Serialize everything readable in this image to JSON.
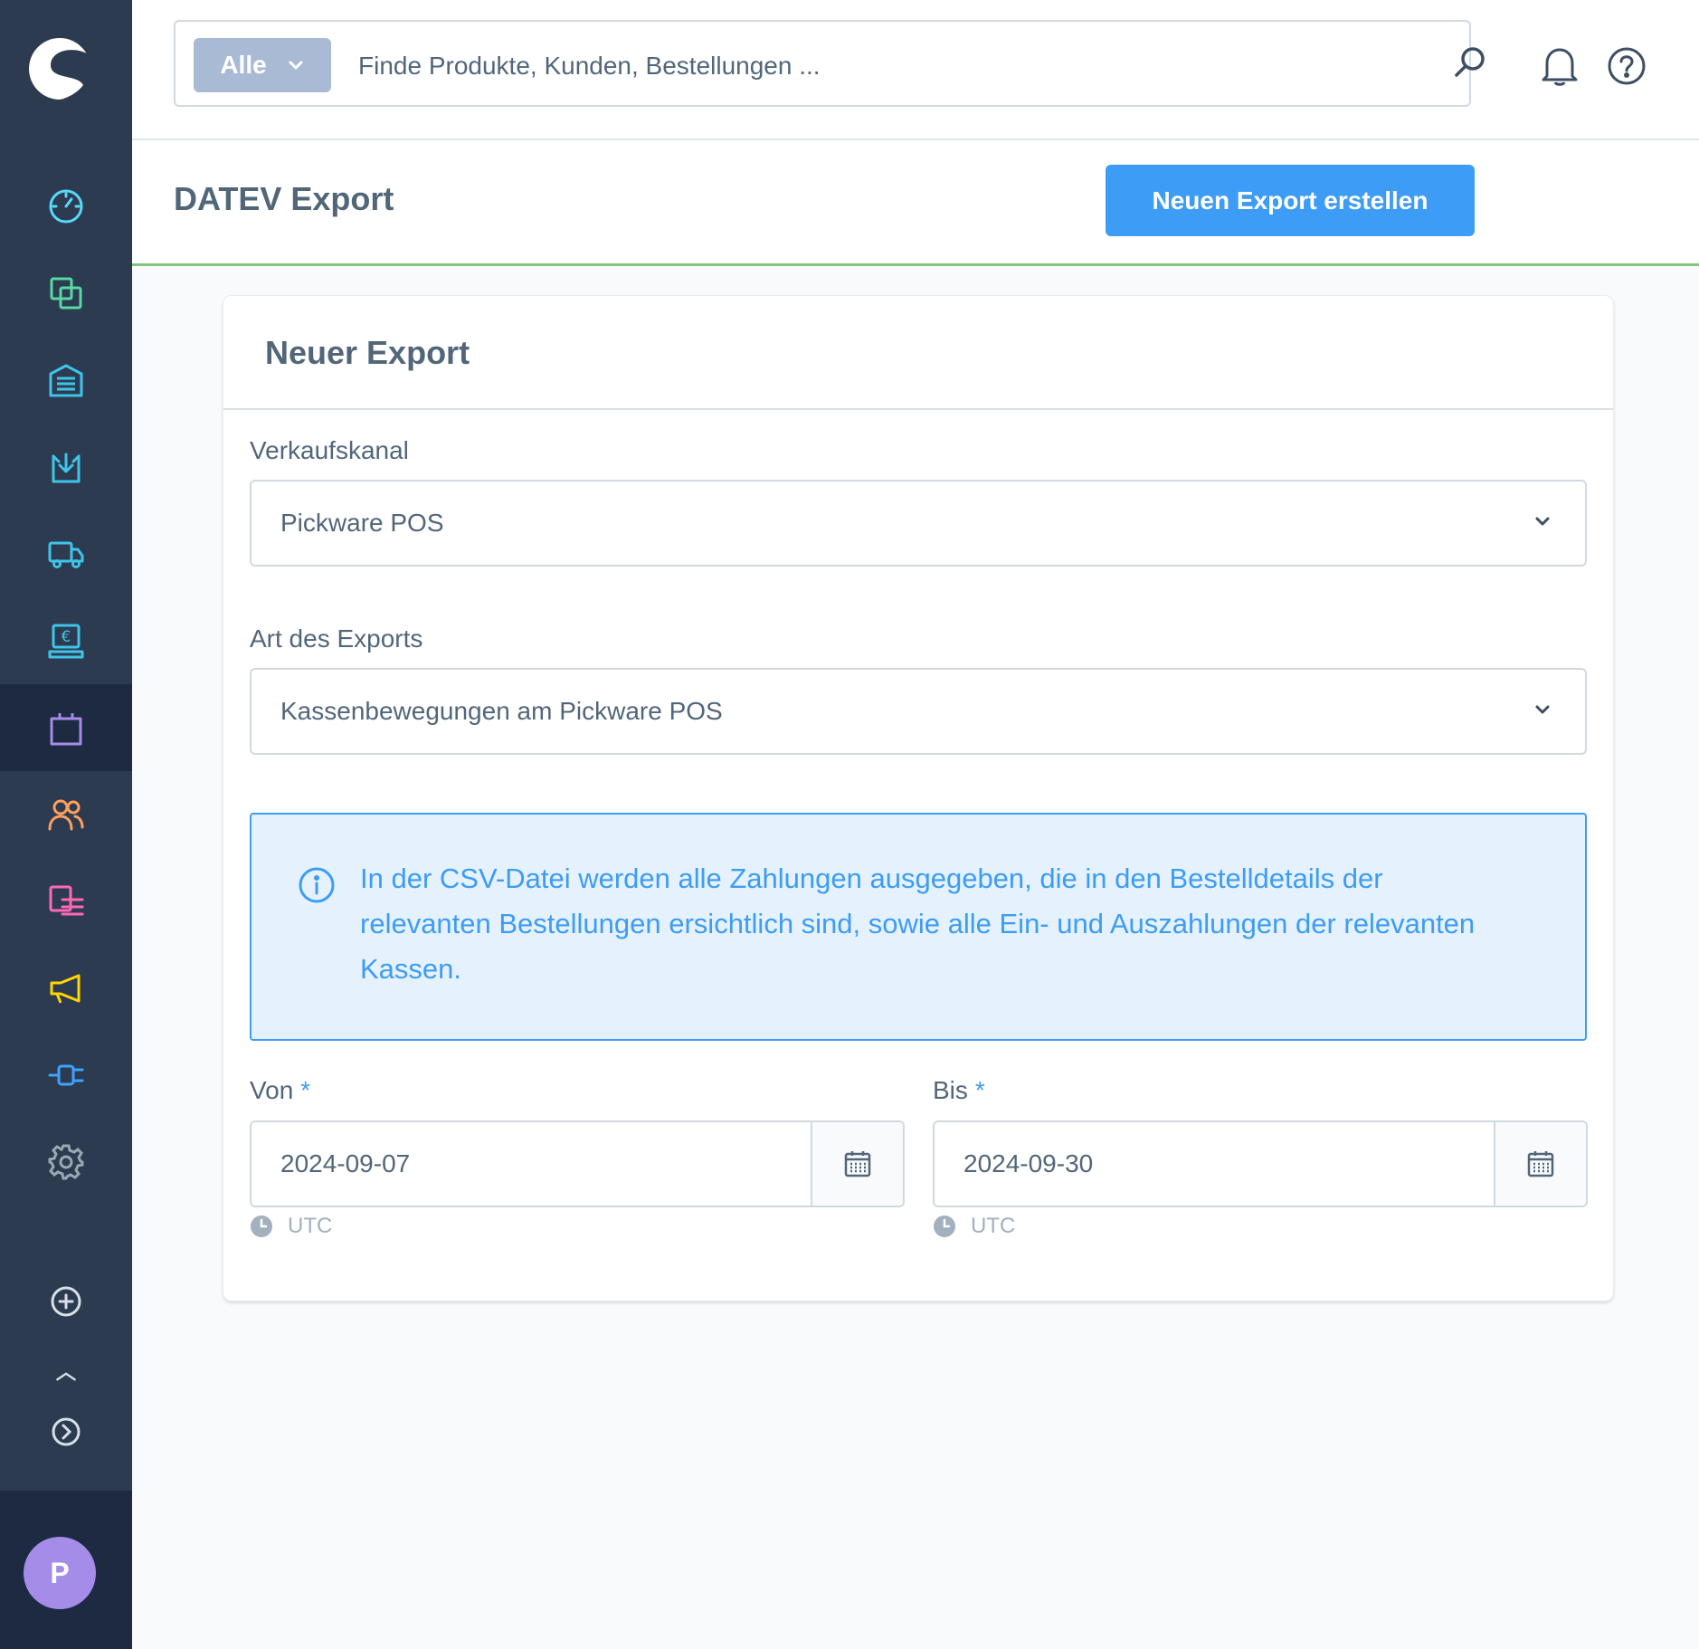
{
  "search": {
    "type_label": "Alle",
    "placeholder": "Finde Produkte, Kunden, Bestellungen ..."
  },
  "header": {
    "title": "DATEV Export",
    "create_button": "Neuen Export erstellen"
  },
  "sidebar": {
    "avatar_initial": "P",
    "colors": {
      "dashboard": "#57d9f9",
      "catalogue": "#57d9a3",
      "warehouse": "#3ec4e9",
      "goods_in": "#3ec4e9",
      "shipping": "#3ec4e9",
      "pos": "#3ec4e9",
      "orders": "#a48ce8",
      "customers": "#ffa05c",
      "content": "#ff68b4",
      "marketing": "#ffd700",
      "extensions": "#3ea2ff",
      "settings": "#9aa8b5"
    }
  },
  "card": {
    "title": "Neuer Export",
    "sales_channel": {
      "label": "Verkaufskanal",
      "value": "Pickware POS"
    },
    "export_type": {
      "label": "Art des Exports",
      "value": "Kassenbewegungen am Pickware POS"
    },
    "info": "In der CSV-Datei werden alle Zahlungen ausgegeben, die in den Bestelldetails der relevanten Bestellungen ersichtlich sind, sowie alle Ein- und Auszahlungen der relevanten Kassen.",
    "from": {
      "label": "Von",
      "required_mark": "*",
      "value": "2024-09-07",
      "timezone": "UTC"
    },
    "to": {
      "label": "Bis",
      "required_mark": "*",
      "value": "2024-09-30",
      "timezone": "UTC"
    }
  },
  "colors": {
    "primary": "#3d9cf5",
    "success_line": "#7fc57a",
    "sidebar_bg": "#2d3b51"
  }
}
